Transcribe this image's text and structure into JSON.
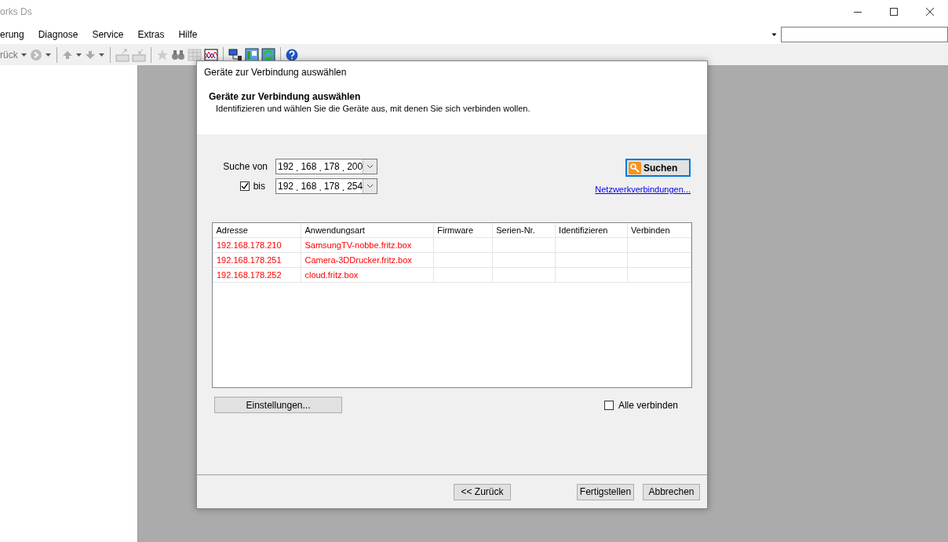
{
  "window": {
    "title": "orks Ds"
  },
  "menu": [
    "erung",
    "Diagnose",
    "Service",
    "Extras",
    "Hilfe"
  ],
  "toolbar": {
    "back_label": "rück"
  },
  "dialog": {
    "title": "Geräte zur Verbindung auswählen",
    "heading": "Geräte zur Verbindung auswählen",
    "subtitle": "Identifizieren und wählen Sie die Geräte aus, mit denen Sie sich verbinden wollen.",
    "search": {
      "from_label": "Suche von",
      "separator": ".",
      "from": [
        "192",
        "168",
        "178",
        "200"
      ],
      "to_label": "bis",
      "to_checked": true,
      "to": [
        "192",
        "168",
        "178",
        "254"
      ]
    },
    "search_button": "Suchen",
    "link": "Netzwerkverbindungen...",
    "table": {
      "columns": [
        "Adresse",
        "Anwendungsart",
        "Firmware",
        "Serien-Nr.",
        "Identifizieren",
        "Verbinden"
      ],
      "rows": [
        [
          "192.168.178.210",
          "SamsungTV-nobbe.fritz.box",
          "",
          "",
          "",
          ""
        ],
        [
          "192.168.178.251",
          "Camera-3DDrucker.fritz.box",
          "",
          "",
          "",
          ""
        ],
        [
          "192.168.178.252",
          "cloud.fritz.box",
          "",
          "",
          "",
          ""
        ]
      ]
    },
    "settings_button": "Einstellungen...",
    "connect_all": {
      "label": "Alle verbinden",
      "checked": false
    },
    "footer_buttons": [
      "<< Zurück",
      "Fertigstellen",
      "Abbrechen"
    ]
  }
}
